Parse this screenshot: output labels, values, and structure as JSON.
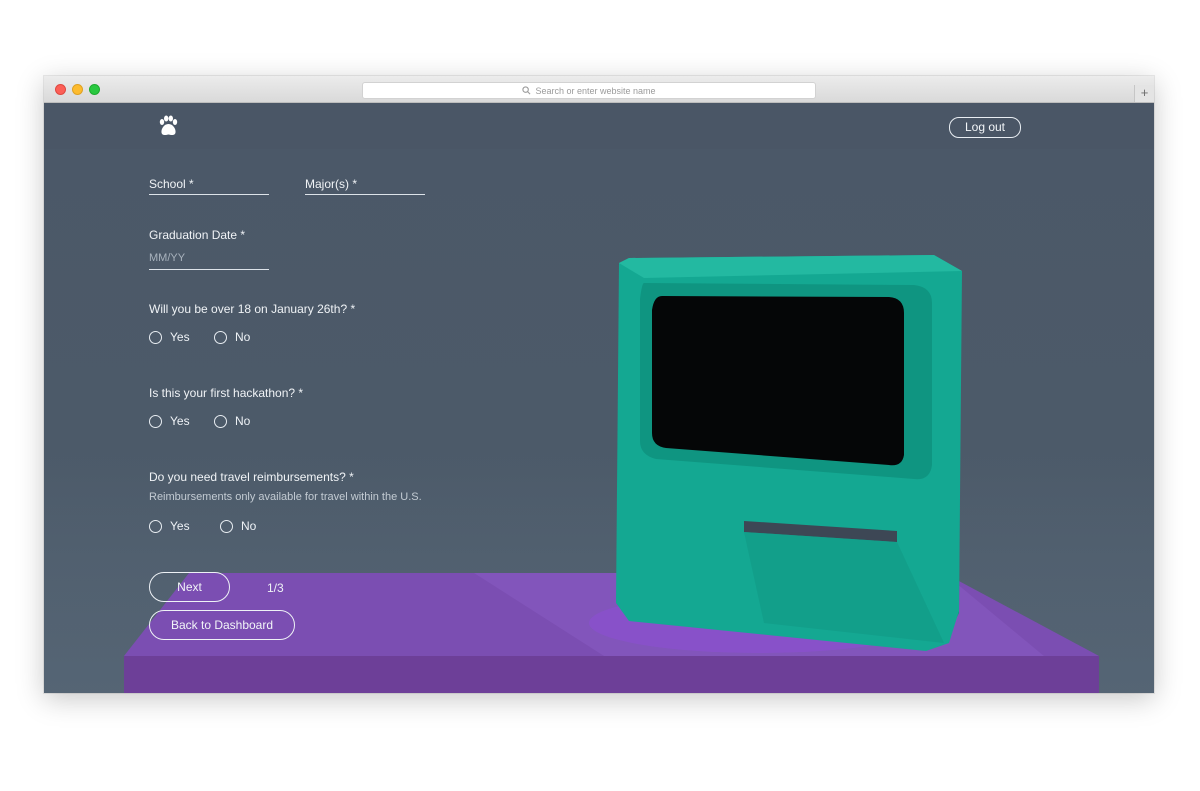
{
  "browser": {
    "address_placeholder": "Search or enter website name",
    "new_tab": "+"
  },
  "header": {
    "logo_icon": "paw-icon",
    "logout_label": "Log out"
  },
  "form": {
    "school_label": "School *",
    "major_label": "Major(s) *",
    "graduation_label": "Graduation Date *",
    "graduation_placeholder": "MM/YY",
    "q_over18": "Will you be over 18 on January 26th? *",
    "q_first_hackathon": "Is this your first hackathon? *",
    "q_travel": "Do you need travel reimbursements? *",
    "travel_note": "Reimbursements only available for travel within the U.S.",
    "yes_label": "Yes",
    "no_label": "No",
    "next_label": "Next",
    "page_indicator": "1/3",
    "back_label": "Back to Dashboard"
  },
  "colors": {
    "background": "#4d5a68",
    "computer": "#14a892",
    "platform": "#7b4fb0",
    "screen": "#050607"
  }
}
